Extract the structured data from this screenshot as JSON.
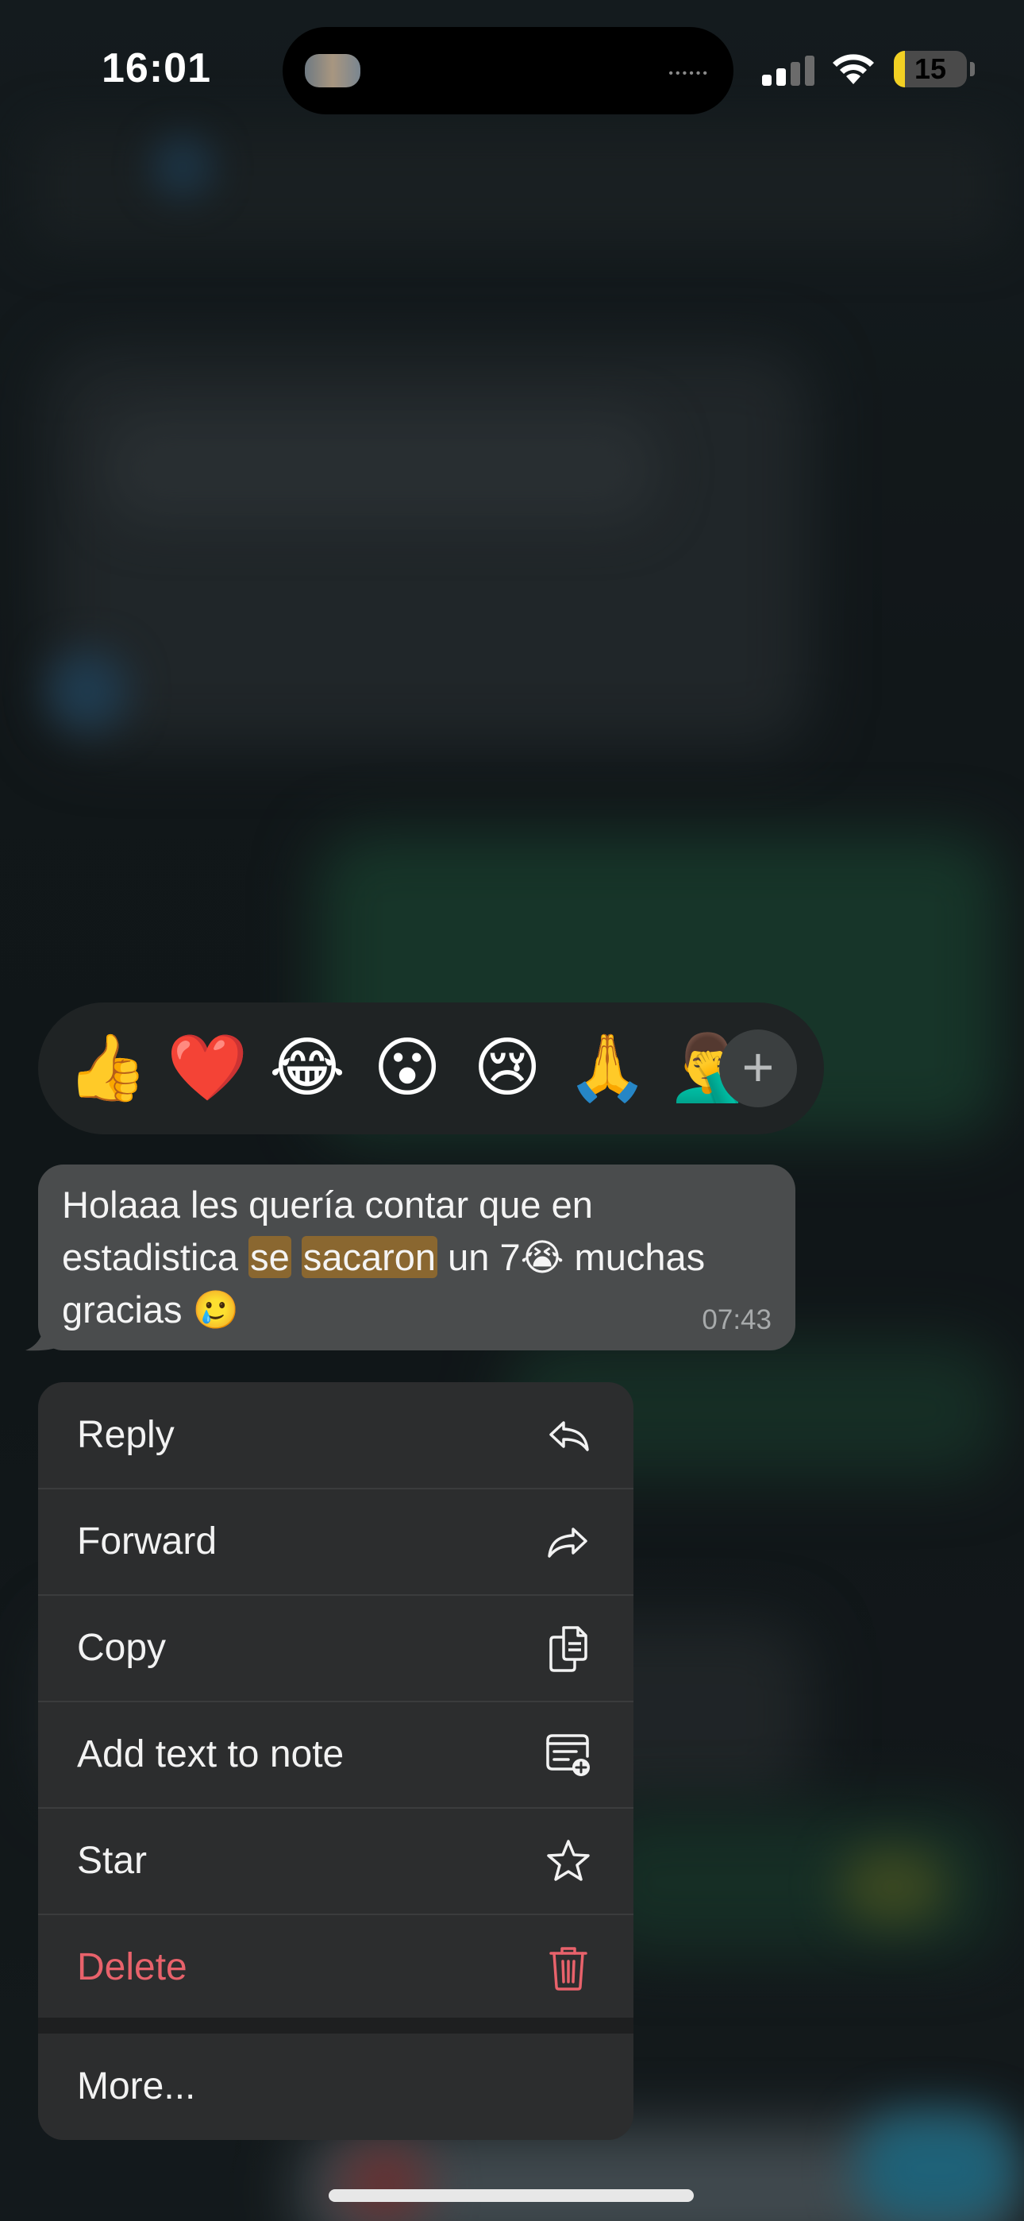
{
  "status_bar": {
    "time": "16:01",
    "battery_level": "15",
    "battery_fraction": 0.15,
    "signal_bars_active": 2,
    "accent_battery": "#f2d023"
  },
  "reactions": {
    "items": [
      "👍",
      "❤️",
      "😂",
      "😮",
      "😢",
      "🙏",
      "🤦‍♂️"
    ],
    "more_label": "+"
  },
  "message": {
    "text_before": "Holaaa les quería contar que en estadistica ",
    "highlight_1": "se",
    "between": " ",
    "highlight_2": "sacaron",
    "text_after": " un 7😭 muchas gracias 🥲",
    "time": "07:43",
    "highlight_color": "#8a6730"
  },
  "menu": {
    "items": [
      {
        "label": "Reply",
        "icon": "reply-icon"
      },
      {
        "label": "Forward",
        "icon": "forward-icon"
      },
      {
        "label": "Copy",
        "icon": "copy-icon"
      },
      {
        "label": "Add text to note",
        "icon": "add-note-icon"
      },
      {
        "label": "Star",
        "icon": "star-icon"
      },
      {
        "label": "Delete",
        "icon": "trash-icon",
        "color": "#e8626b"
      }
    ],
    "more_label": "More..."
  }
}
